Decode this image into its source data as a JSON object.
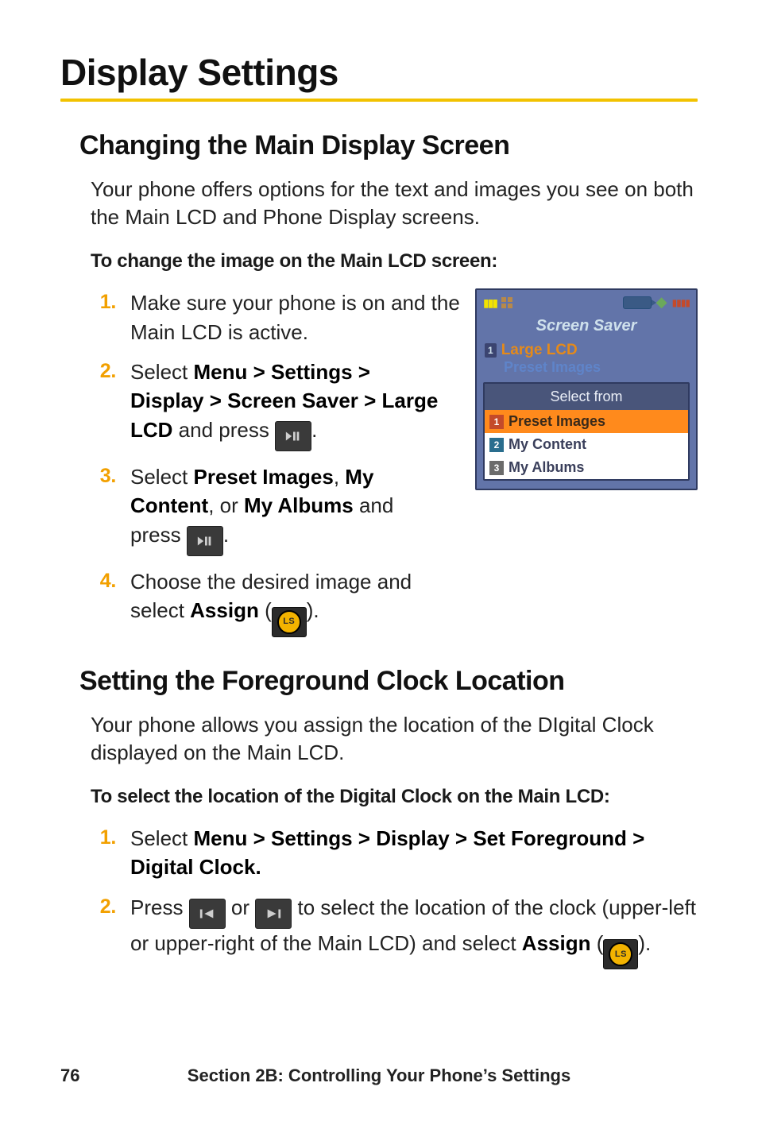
{
  "title": "Display Settings",
  "section1": {
    "heading": "Changing the Main Display Screen",
    "intro": "Your phone offers options for the text and images you see on both the Main LCD and Phone Display screens.",
    "subhead": "To change the image on the Main LCD screen:",
    "steps": {
      "s1": "Make sure your phone is on and the Main LCD is active.",
      "s2a": "Select ",
      "s2b_bold": "Menu > Settings > Display > Screen Saver > Large LCD",
      "s2c": " and press ",
      "s2_period": ".",
      "s3a": "Select ",
      "s3_pi": "Preset Images",
      "s3_sep1": ", ",
      "s3_mc": "My Content",
      "s3_sep2": ", or ",
      "s3_ma": "My Albums",
      "s3c": " and press ",
      "s3_period": ".",
      "s4a": "Choose the desired image and select ",
      "s4_assign": "Assign",
      "s4b": " (",
      "s4d": ")."
    }
  },
  "phone": {
    "screen_title": "Screen Saver",
    "row1_num": "1",
    "row1_label": "Large LCD",
    "row1_sub": "Preset Images",
    "popup_head": "Select from",
    "opt1": "Preset Images",
    "opt2": "My Content",
    "opt3": "My Albums"
  },
  "section2": {
    "heading": "Setting the Foreground Clock Location",
    "intro": "Your phone allows you assign the location of the DIgital Clock displayed on the Main LCD.",
    "subhead": "To select the location of the Digital Clock on the Main LCD:",
    "steps": {
      "s1a": "Select ",
      "s1b_bold": "Menu > Settings > Display > Set Foreground > Digital Clock.",
      "s2a": "Press ",
      "s2b": " or ",
      "s2c": " to select the location of the clock (upper-left or upper-right of the Main LCD) and select ",
      "s2_assign": "Assign",
      "s2d": " (",
      "s2f": ")."
    }
  },
  "footer": {
    "page": "76",
    "section_label": "Section 2B: Controlling Your Phone’s Settings"
  },
  "icons": {
    "ls_label": "LS"
  }
}
